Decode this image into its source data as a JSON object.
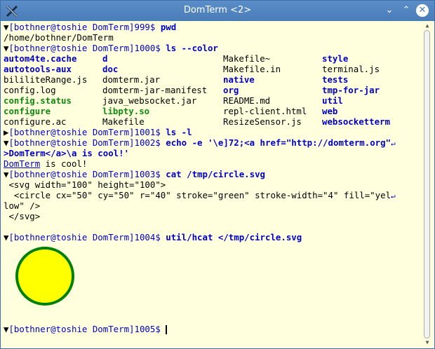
{
  "window": {
    "title": "DomTerm <2>",
    "app_icon": "domterm-x-icon",
    "controls": {
      "minimize": "⌄",
      "maximize": "⌃",
      "close": "✕"
    }
  },
  "terminal": {
    "prompts": [
      "[bothner@toshie DomTerm]999$ ",
      "[bothner@toshie DomTerm]1000$ ",
      "[bothner@toshie DomTerm]1001$ ",
      "[bothner@toshie DomTerm]1002$ ",
      "[bothner@toshie DomTerm]1003$ ",
      "[bothner@toshie DomTerm]1004$ ",
      "[bothner@toshie DomTerm]1005$ "
    ],
    "commands": [
      "pwd",
      "ls --color",
      "ls -l",
      "echo -e '\\e]72;<a href=\"http://domterm.org\"",
      "cat /tmp/circle.svg",
      "util/hcat </tmp/circle.svg",
      ""
    ],
    "markers": {
      "expanded": "▼",
      "collapsed": "▶",
      "wrap": "↵"
    },
    "pwd_output": "/home/bothner/DomTerm",
    "ls_columns": [
      [
        {
          "name": "autom4te.cache",
          "kind": "dir"
        },
        {
          "name": "autotools-aux",
          "kind": "dir"
        },
        {
          "name": "bililiteRange.js",
          "kind": "plain"
        },
        {
          "name": "config.log",
          "kind": "plain"
        },
        {
          "name": "config.status",
          "kind": "exe"
        },
        {
          "name": "configure",
          "kind": "exe"
        },
        {
          "name": "configure.ac",
          "kind": "plain"
        }
      ],
      [
        {
          "name": "d",
          "kind": "dir"
        },
        {
          "name": "doc",
          "kind": "dir"
        },
        {
          "name": "domterm.jar",
          "kind": "plain"
        },
        {
          "name": "domterm-jar-manifest",
          "kind": "plain"
        },
        {
          "name": "java_websocket.jar",
          "kind": "plain"
        },
        {
          "name": "libpty.so",
          "kind": "exe"
        },
        {
          "name": "Makefile",
          "kind": "plain"
        }
      ],
      [
        {
          "name": "Makefile~",
          "kind": "plain"
        },
        {
          "name": "Makefile.in",
          "kind": "plain"
        },
        {
          "name": "native",
          "kind": "dir"
        },
        {
          "name": "org",
          "kind": "dir"
        },
        {
          "name": "README.md",
          "kind": "plain"
        },
        {
          "name": "repl-client.html",
          "kind": "plain"
        },
        {
          "name": "ResizeSensor.js",
          "kind": "plain"
        }
      ],
      [
        {
          "name": "style",
          "kind": "dir"
        },
        {
          "name": "terminal.js",
          "kind": "plain"
        },
        {
          "name": "tests",
          "kind": "dir"
        },
        {
          "name": "tmp-for-jar",
          "kind": "dir"
        },
        {
          "name": "util",
          "kind": "dir"
        },
        {
          "name": "web",
          "kind": "dir"
        },
        {
          "name": "websocketterm",
          "kind": "dir"
        }
      ]
    ],
    "echo_continuation": ">DomTerm</a>\\a is cool!'",
    "echo_output_link": "DomTerm",
    "echo_output_rest": " is cool!",
    "cat_output": [
      " <svg width=\"100\" height=\"100\">",
      "  <circle cx=\"50\" cy=\"50\" r=\"40\" stroke=\"green\" stroke-width=\"4\" fill=\"yel",
      "low\" />",
      " </svg>"
    ],
    "circle": {
      "fill": "#ffff00",
      "stroke": "#008000"
    }
  },
  "colors": {
    "background": "#ffffde",
    "prompt": "#0000c8",
    "directory": "#0000c8",
    "executable": "#108a10",
    "titlebar": "#4a7cb8"
  }
}
